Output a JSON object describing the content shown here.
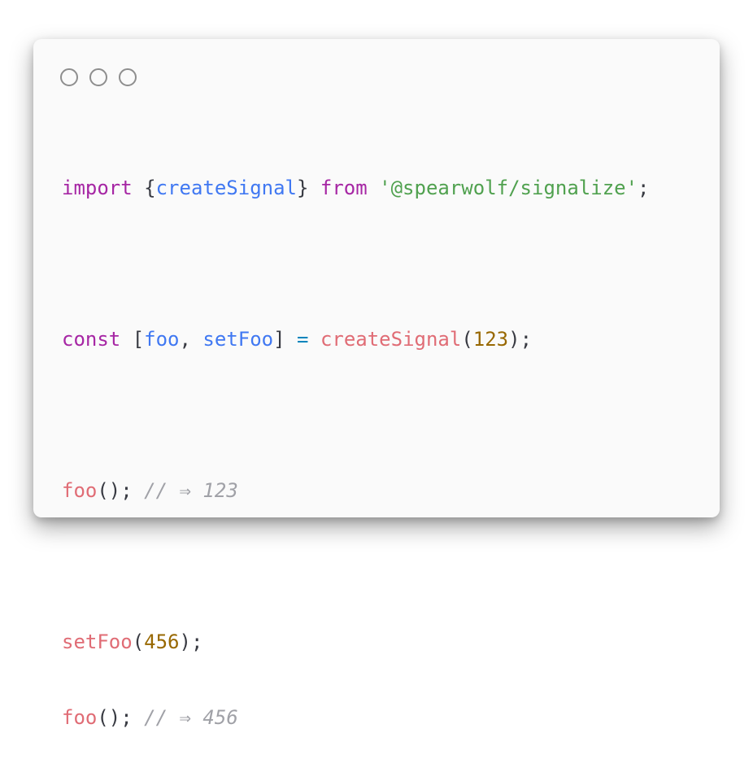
{
  "window": {
    "controls": [
      "close",
      "minimize",
      "maximize"
    ]
  },
  "code": {
    "line1": {
      "kw_import": "import",
      "brace_open": "{",
      "ident": "createSignal",
      "brace_close": "}",
      "kw_from": "from",
      "module": "'@spearwolf/signalize'",
      "semi": ";"
    },
    "line2": {
      "kw_const": "const",
      "bracket_open": "[",
      "foo": "foo",
      "comma": ",",
      "setFoo": "setFoo",
      "bracket_close": "]",
      "eq": "=",
      "call": "createSignal",
      "paren_open": "(",
      "arg": "123",
      "paren_close": ");"
    },
    "line3": {
      "call": "foo",
      "parens": "();",
      "comment": "// ⇒ 123"
    },
    "line4": {
      "call": "setFoo",
      "paren_open": "(",
      "arg": "456",
      "paren_close": ");"
    },
    "line5": {
      "call": "foo",
      "parens": "();",
      "comment": "// ⇒ 456"
    }
  },
  "colors": {
    "keyword": "#a626a4",
    "function": "#e06c75",
    "variable": "#4078f2",
    "string": "#50a14f",
    "number": "#986801",
    "operator": "#0184bc",
    "comment": "#a0a1a7"
  }
}
